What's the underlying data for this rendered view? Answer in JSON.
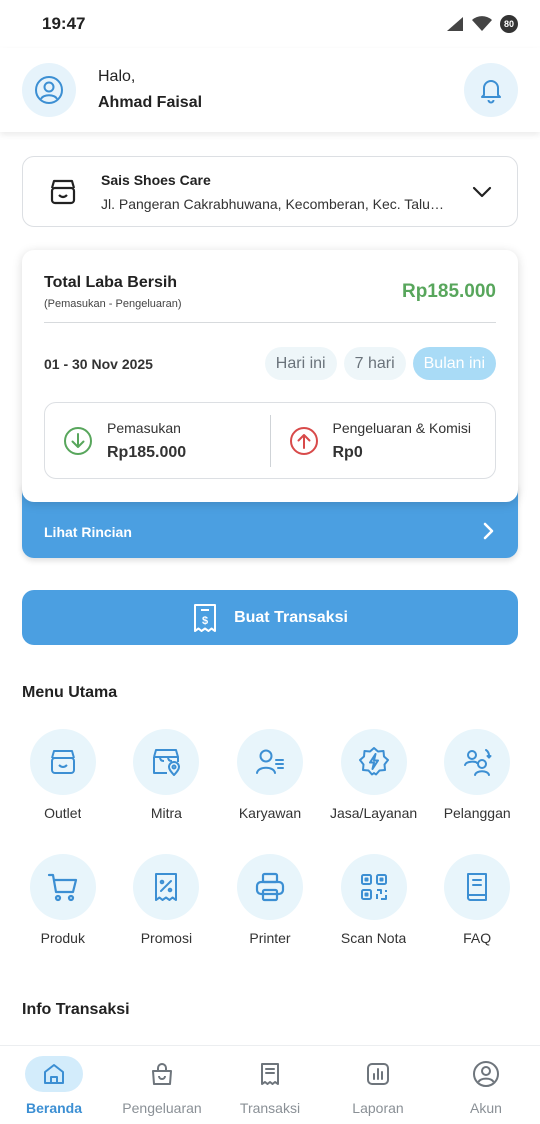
{
  "status_bar": {
    "time": "19:47",
    "battery": "80"
  },
  "header": {
    "greeting": "Halo,",
    "user_name": "Ahmad Faisal"
  },
  "outlet": {
    "name": "Sais Shoes Care",
    "address": "Jl. Pangeran Cakrabhuwana, Kecomberan, Kec. Talun, Kabupaten Cirebon"
  },
  "summary": {
    "title": "Total Laba Bersih",
    "subtitle": "(Pemasukan - Pengeluaran)",
    "amount": "Rp185.000",
    "period": "01 - 30 Nov 2025",
    "filters": [
      "Hari ini",
      "7 hari",
      "Bulan ini"
    ],
    "active_filter": "Bulan ini",
    "income_label": "Pemasukan",
    "income_value": "Rp185.000",
    "expense_label": "Pengeluaran & Komisi",
    "expense_value": "Rp0",
    "details_label": "Lihat Rincian"
  },
  "create_transaction_label": "Buat Transaksi",
  "main_menu": {
    "title": "Menu Utama",
    "items": [
      {
        "label": "Outlet",
        "icon": "store-icon"
      },
      {
        "label": "Mitra",
        "icon": "partner-store-icon"
      },
      {
        "label": "Karyawan",
        "icon": "employee-icon"
      },
      {
        "label": "Jasa/Layanan",
        "icon": "service-badge-icon"
      },
      {
        "label": "Pelanggan",
        "icon": "customer-icon"
      },
      {
        "label": "Produk",
        "icon": "cart-icon"
      },
      {
        "label": "Promosi",
        "icon": "promo-icon"
      },
      {
        "label": "Printer",
        "icon": "printer-icon"
      },
      {
        "label": "Scan Nota",
        "icon": "qr-scan-icon"
      },
      {
        "label": "FAQ",
        "icon": "book-icon"
      }
    ]
  },
  "info_title": "Info Transaksi",
  "bottom_nav": {
    "items": [
      {
        "label": "Beranda",
        "icon": "home-icon"
      },
      {
        "label": "Pengeluaran",
        "icon": "bag-icon"
      },
      {
        "label": "Transaksi",
        "icon": "receipt-icon"
      },
      {
        "label": "Laporan",
        "icon": "chart-icon"
      },
      {
        "label": "Akun",
        "icon": "account-icon"
      }
    ],
    "active": "Beranda"
  },
  "colors": {
    "primary": "#4b9fe1",
    "profit_green": "#58a65c",
    "income_green": "#58a65c",
    "expense_red": "#d84a4a",
    "icon_blue": "#3c8fd3"
  }
}
